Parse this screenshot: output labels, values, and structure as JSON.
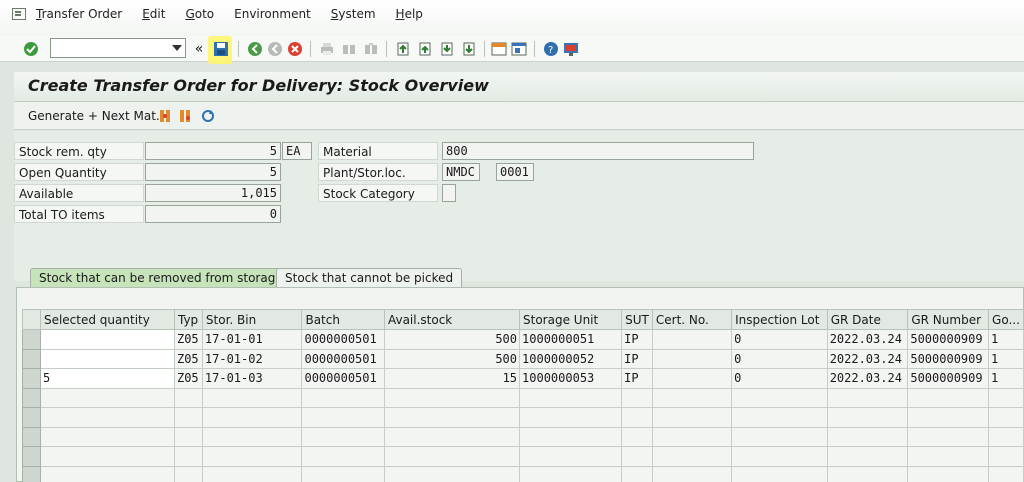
{
  "menu": {
    "items": [
      {
        "u": "T",
        "rest": "ransfer Order"
      },
      {
        "u": "E",
        "rest": "dit"
      },
      {
        "u": "G",
        "rest": "oto"
      },
      {
        "u": "",
        "rest": "Environment"
      },
      {
        "u": "S",
        "rest": "ystem"
      },
      {
        "u": "H",
        "rest": "elp"
      }
    ]
  },
  "toolbar": {
    "command_value": "",
    "back_chevrons": "«"
  },
  "screen_title": "Create Transfer Order for Delivery: Stock Overview",
  "app_toolbar": {
    "generate_label": "Generate + Next Mat."
  },
  "form": {
    "stock_rem_qty": {
      "label": "Stock rem. qty",
      "value": "5",
      "unit": "EA"
    },
    "open_quantity": {
      "label": "Open Quantity",
      "value": "5"
    },
    "available": {
      "label": "Available",
      "value": "1,015"
    },
    "total_to_items": {
      "label": "Total TO items",
      "value": "0"
    },
    "material": {
      "label": "Material",
      "value": "800"
    },
    "plant_storloc": {
      "label": "Plant/Stor.loc.",
      "plant": "NMDC",
      "storloc": "0001"
    },
    "stock_category": {
      "label": "Stock Category",
      "value": ""
    }
  },
  "tabs": [
    {
      "label": "Stock that can be removed from storage",
      "active": true
    },
    {
      "label": "Stock that cannot be picked",
      "active": false
    }
  ],
  "table": {
    "columns": [
      "Selected quantity",
      "Typ",
      "Stor. Bin",
      "Batch",
      "Avail.stock",
      "Storage Unit",
      "SUT",
      "Cert. No.",
      "Inspection Lot",
      "GR Date",
      "GR Number",
      "Go..."
    ],
    "rows": [
      {
        "selected_qty": "",
        "typ": "Z05",
        "bin": "17-01-01",
        "batch": "0000000501",
        "avail": "500",
        "su": "1000000051",
        "sut": "IP",
        "cert": "",
        "insp": "0",
        "grdate": "2022.03.24",
        "grnum": "5000000909",
        "go": "1"
      },
      {
        "selected_qty": "",
        "typ": "Z05",
        "bin": "17-01-02",
        "batch": "0000000501",
        "avail": "500",
        "su": "1000000052",
        "sut": "IP",
        "cert": "",
        "insp": "0",
        "grdate": "2022.03.24",
        "grnum": "5000000909",
        "go": "1"
      },
      {
        "selected_qty": "5",
        "typ": "Z05",
        "bin": "17-01-03",
        "batch": "0000000501",
        "avail": "15",
        "su": "1000000053",
        "sut": "IP",
        "cert": "",
        "insp": "0",
        "grdate": "2022.03.24",
        "grnum": "5000000909",
        "go": "1"
      }
    ],
    "empty_rows": 5
  },
  "colors": {
    "highlight": "#fff56b",
    "active_tab": "#c7e3ba",
    "background": "#dfe6e0"
  }
}
